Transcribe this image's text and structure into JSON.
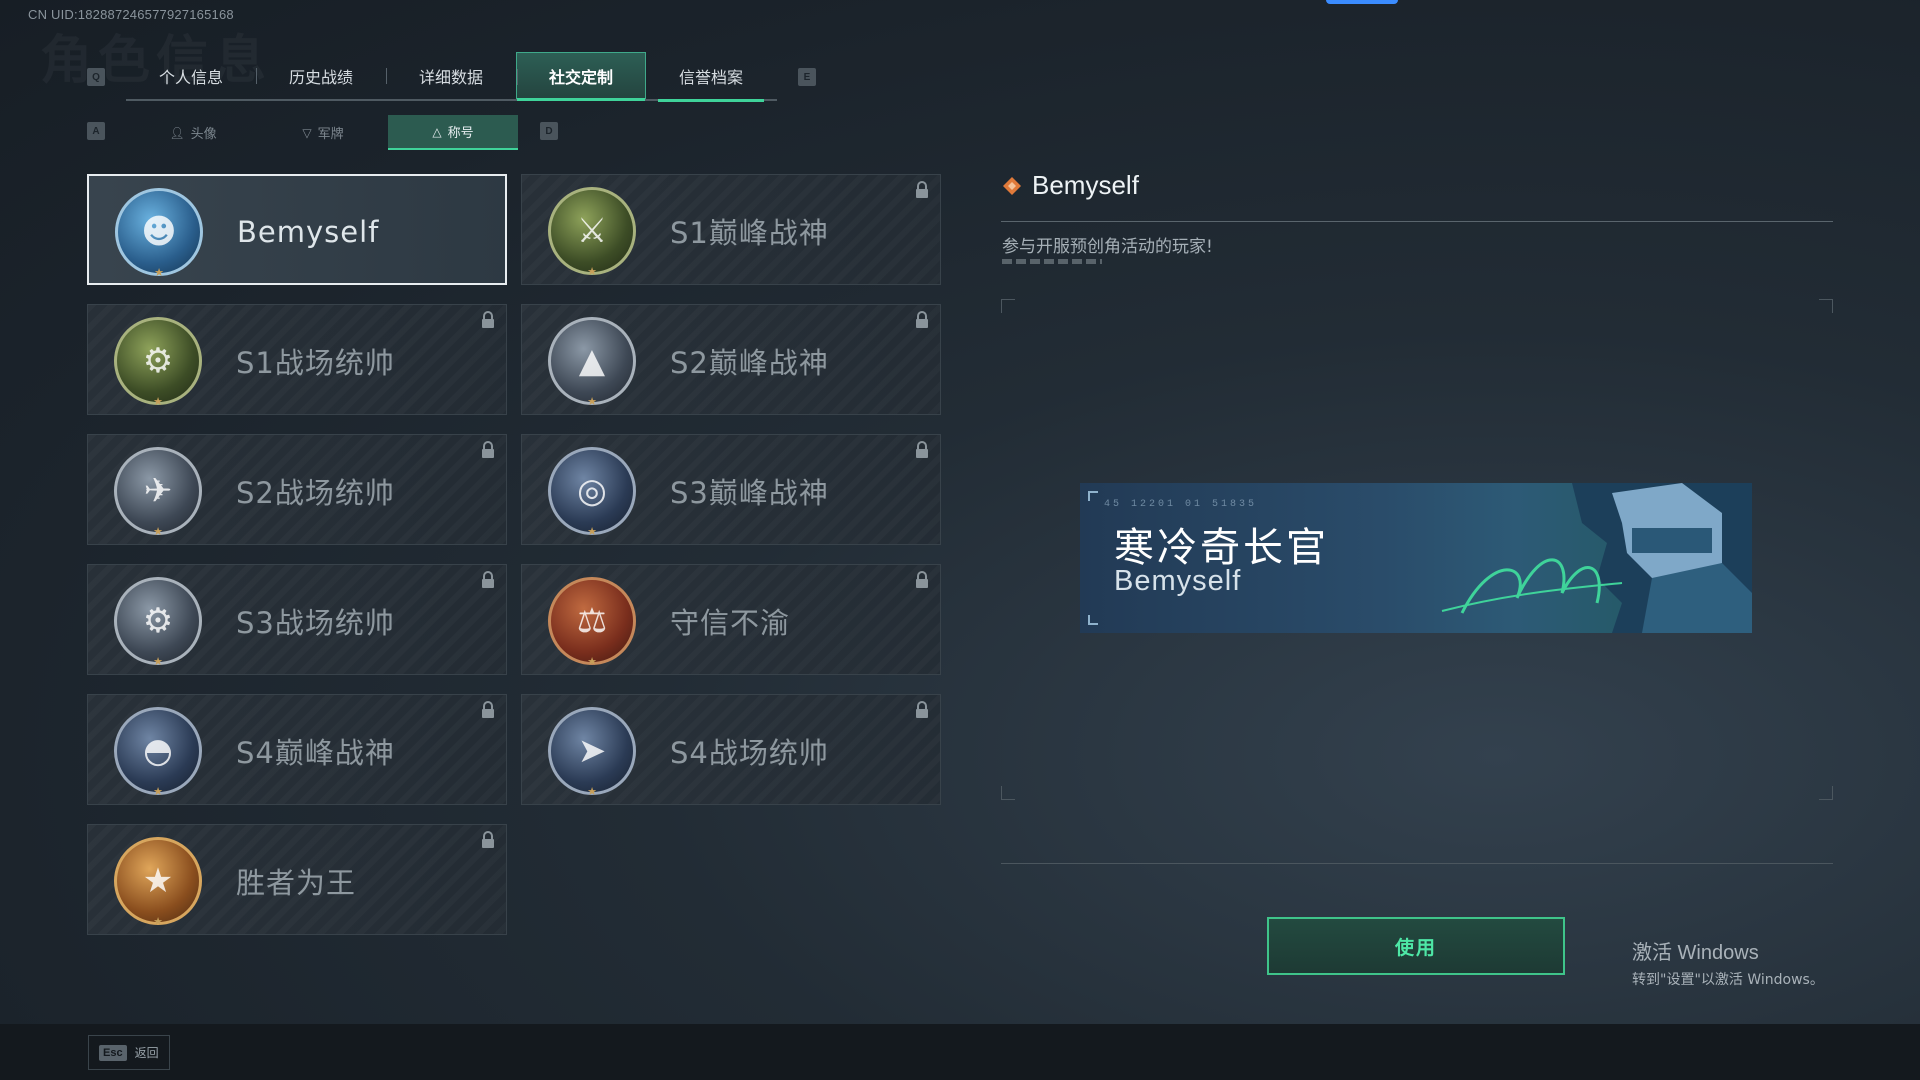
{
  "uid": "CN UID:182887246577927165168",
  "ghost_title": "角色信息",
  "tabs": {
    "left_key": "Q",
    "right_key": "E",
    "items": [
      {
        "label": "个人信息"
      },
      {
        "label": "历史战绩"
      },
      {
        "label": "详细数据"
      },
      {
        "label": "社交定制"
      },
      {
        "label": "信誉档案"
      }
    ],
    "active_index": 3
  },
  "subtabs": {
    "left_key": "A",
    "right_key": "D",
    "items": [
      {
        "label": "头像",
        "icon": "person-icon"
      },
      {
        "label": "军牌",
        "icon": "dog-tag-icon"
      },
      {
        "label": "称号",
        "icon": "triangle-icon"
      }
    ],
    "active_index": 2
  },
  "titles": [
    {
      "name": "Bemyself",
      "emblem": "soldier-signature-emblem",
      "locked": false,
      "selected": true
    },
    {
      "name": "S1巅峰战神",
      "emblem": "crocodile-emblem",
      "locked": true
    },
    {
      "name": "S1战场统帅",
      "emblem": "tank-emblem",
      "locked": true
    },
    {
      "name": "S2巅峰战神",
      "emblem": "pyramid-emblem",
      "locked": true
    },
    {
      "name": "S2战场统帅",
      "emblem": "helicopter-emblem",
      "locked": true
    },
    {
      "name": "S3巅峰战神",
      "emblem": "globe-emblem",
      "locked": true
    },
    {
      "name": "S3战场统帅",
      "emblem": "armored-vehicle-emblem",
      "locked": true
    },
    {
      "name": "守信不渝",
      "emblem": "scales-emblem",
      "locked": true
    },
    {
      "name": "S4巅峰战神",
      "emblem": "helmet-emblem",
      "locked": true
    },
    {
      "name": "S4战场统帅",
      "emblem": "missile-emblem",
      "locked": true
    },
    {
      "name": "胜者为王",
      "emblem": "medal-emblem",
      "locked": true
    }
  ],
  "detail": {
    "name": "Bemyself",
    "description": "参与开服预创角活动的玩家!",
    "banner": {
      "code": "45 12201  01 51835",
      "title": "寒冷奇长官",
      "name": "Bemyself"
    },
    "use_button": "使用"
  },
  "windows_activation": {
    "line1": "激活 Windows",
    "line2": "转到\"设置\"以激活 Windows。"
  },
  "footer": {
    "esc_key": "Esc",
    "esc_label": "返回"
  },
  "colors": {
    "accent": "#3fd39a",
    "selected_border": "#e8edf0"
  }
}
